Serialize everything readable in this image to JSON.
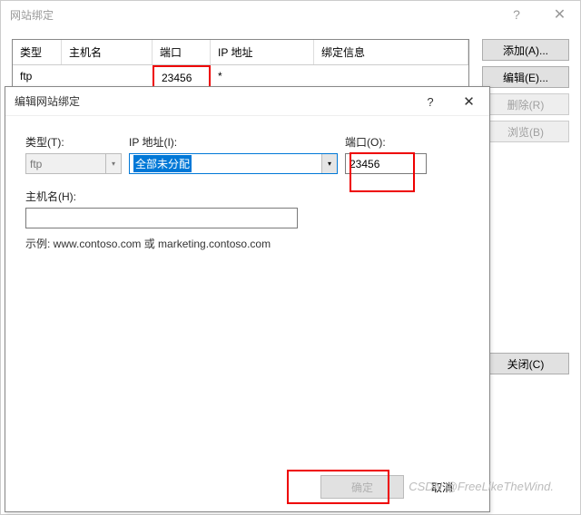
{
  "parent": {
    "title": "网站绑定",
    "columns": {
      "type": "类型",
      "host": "主机名",
      "port": "端口",
      "ip": "IP 地址",
      "bind": "绑定信息"
    },
    "row": {
      "type": "ftp",
      "host": "",
      "port": "23456",
      "ip": "*",
      "bind": ""
    },
    "buttons": {
      "add": "添加(A)...",
      "edit": "编辑(E)...",
      "remove": "删除(R)",
      "browse": "浏览(B)",
      "close": "关闭(C)"
    }
  },
  "child": {
    "title": "编辑网站绑定",
    "labels": {
      "type": "类型(T):",
      "ip": "IP 地址(I):",
      "port": "端口(O):",
      "host": "主机名(H):"
    },
    "values": {
      "type": "ftp",
      "ip": "全部未分配",
      "port": "23456",
      "host": ""
    },
    "example": "示例: www.contoso.com 或 marketing.contoso.com",
    "buttons": {
      "ok": "确定",
      "cancel": "取消"
    }
  },
  "watermark": "CSDN @FreeLikeTheWind."
}
